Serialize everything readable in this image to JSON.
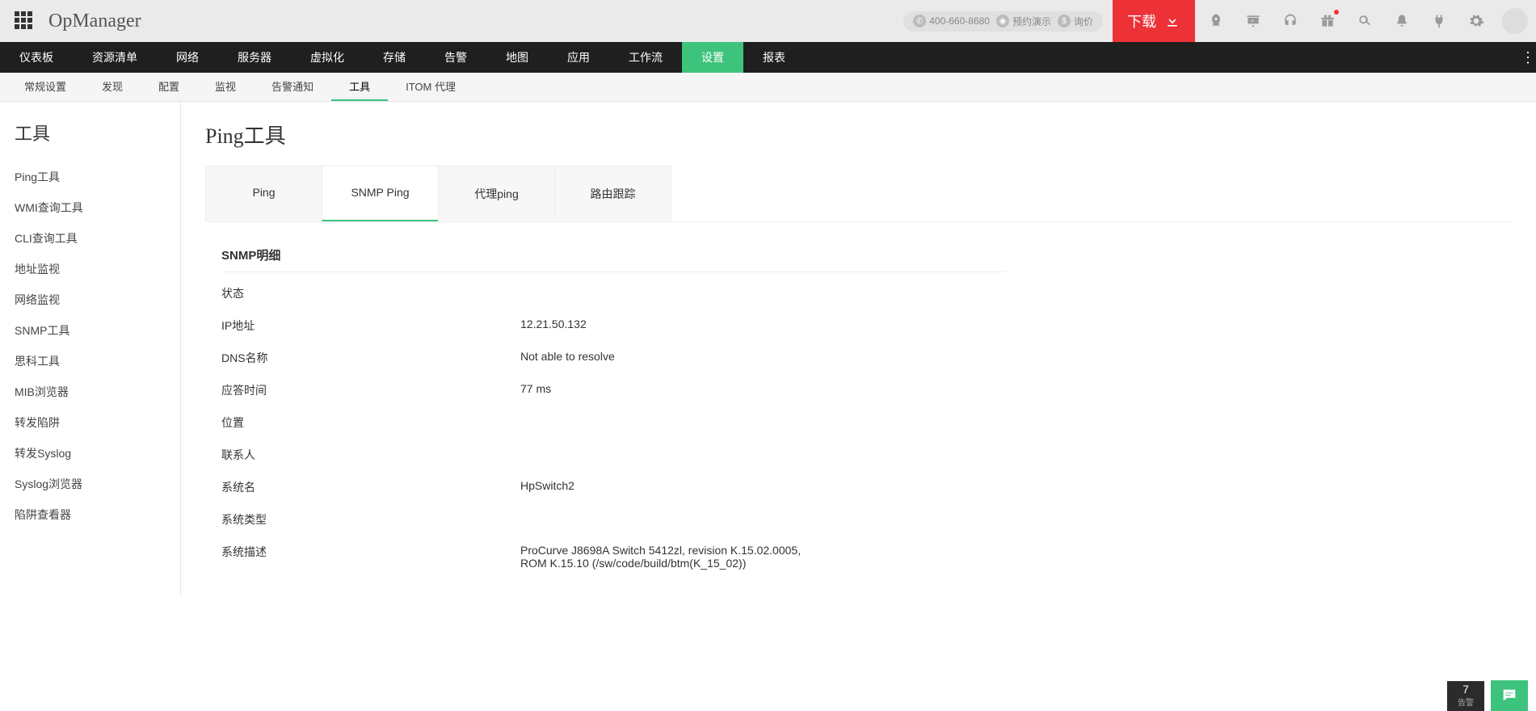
{
  "header": {
    "logo": "OpManager",
    "phone": "400-660-8680",
    "demo": "预约演示",
    "quote": "询价",
    "download": "下载"
  },
  "mainnav": {
    "items": [
      "仪表板",
      "资源清单",
      "网络",
      "服务器",
      "虚拟化",
      "存储",
      "告警",
      "地图",
      "应用",
      "工作流",
      "设置",
      "报表"
    ],
    "active_index": 10
  },
  "subnav": {
    "items": [
      "常规设置",
      "发现",
      "配置",
      "监视",
      "告警通知",
      "工具",
      "ITOM 代理"
    ],
    "active_index": 5
  },
  "sidebar": {
    "title": "工具",
    "items": [
      "Ping工具",
      "WMI查询工具",
      "CLI查询工具",
      "地址监视",
      "网络监视",
      "SNMP工具",
      "思科工具",
      "MIB浏览器",
      "转发陷阱",
      "转发Syslog",
      "Syslog浏览器",
      "陷阱查看器"
    ]
  },
  "page": {
    "title": "Ping工具",
    "tabs": [
      "Ping",
      "SNMP Ping",
      "代理ping",
      "路由跟踪"
    ],
    "active_tab": 1
  },
  "detail": {
    "title": "SNMP明细",
    "rows": [
      {
        "k": "状态",
        "v": ""
      },
      {
        "k": "IP地址",
        "v": "12.21.50.132"
      },
      {
        "k": "DNS名称",
        "v": "Not able to resolve"
      },
      {
        "k": "应答时间",
        "v": "77 ms"
      },
      {
        "k": "位置",
        "v": ""
      },
      {
        "k": "联系人",
        "v": ""
      },
      {
        "k": "系统名",
        "v": "HpSwitch2"
      },
      {
        "k": "系统类型",
        "v": ""
      },
      {
        "k": "系统描述",
        "v": "ProCurve J8698A Switch 5412zl, revision K.15.02.0005, ROM K.15.10 (/sw/code/build/btm(K_15_02))"
      }
    ]
  },
  "bottom": {
    "count": "7",
    "count_label": "告警"
  }
}
